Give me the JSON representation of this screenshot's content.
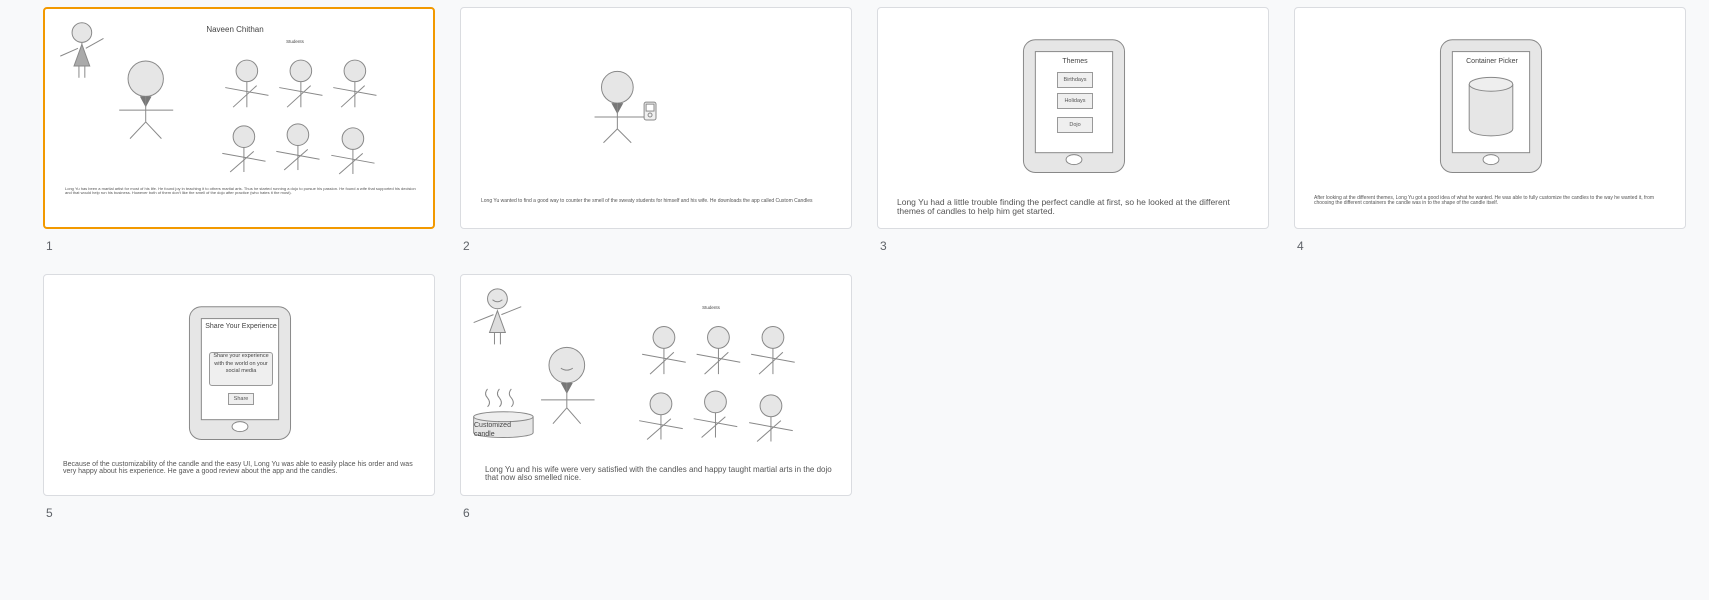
{
  "slides": [
    {
      "number": "1",
      "title": "Naveen Chithan",
      "students_label": "Students",
      "caption": "Long Yu has been a martial artist for most of his life. He found joy in teaching it to others martial arts. Thus he started running a dojo to pursue his passion. He found a wife that supported his decision and that would help run his business. However both of them don't like the smell of the dojo after practice (who hates it the most)."
    },
    {
      "number": "2",
      "caption": "Long Yu wanted to find a good way to counter the smell of the sweaty students for himself and his wife. He downloads the app called Custom Candles"
    },
    {
      "number": "3",
      "screen_title": "Themes",
      "options": [
        "Birthdays",
        "Holidays",
        "Dojo"
      ],
      "caption": "Long Yu had a little trouble finding the perfect candle at first, so he looked at the different themes of candles to help him get started."
    },
    {
      "number": "4",
      "screen_title": "Container Picker",
      "caption": "After looking at the different themes, Long Yu got a good idea of what he wanted. He was able to fully customize the candles to the way he wanted it, from choosing the different containers the candle was in to the shape of the candle itself."
    },
    {
      "number": "5",
      "screen_title": "Share Your Experience",
      "share_text": "Share your experience with the world on your social media",
      "share_button": "Share",
      "caption": "Because of the customizability of the candle and the easy UI, Long Yu was able to easily place his order and was very happy about his experience. He gave a good review about the app and the candles."
    },
    {
      "number": "6",
      "students_label": "Students",
      "candle_label": "Customized candle",
      "caption": "Long Yu and his wife were very satisfied with the candles and happy taught martial arts in the dojo that now also smelled nice."
    }
  ],
  "colors": {
    "selected_border": "#f29900",
    "thumb_border": "#dadce0"
  }
}
